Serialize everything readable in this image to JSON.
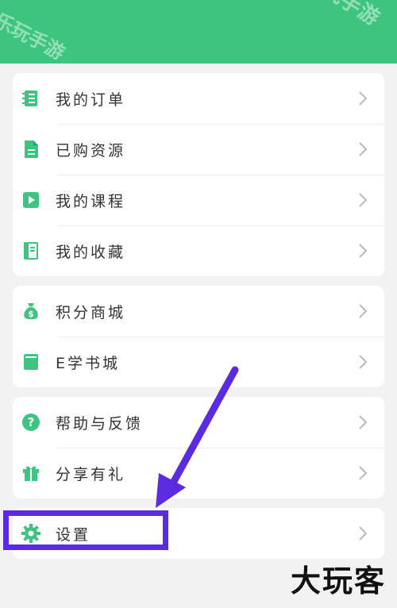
{
  "watermark": {
    "top": "乐玩手游",
    "left": "乐玩手游"
  },
  "card1": {
    "items": [
      {
        "label": "我的订单",
        "icon": "order-list-icon"
      },
      {
        "label": "已购资源",
        "icon": "document-icon"
      },
      {
        "label": "我的课程",
        "icon": "play-video-icon"
      },
      {
        "label": "我的收藏",
        "icon": "bookmark-book-icon"
      }
    ]
  },
  "card2": {
    "items": [
      {
        "label": "积分商城",
        "icon": "money-bag-icon"
      },
      {
        "label": "E学书城",
        "icon": "book-icon"
      }
    ]
  },
  "card3": {
    "items": [
      {
        "label": "帮助与反馈",
        "icon": "help-question-icon"
      },
      {
        "label": "分享有礼",
        "icon": "gift-icon"
      }
    ]
  },
  "card4": {
    "items": [
      {
        "label": "设置",
        "icon": "gear-icon"
      }
    ]
  },
  "brand": "大玩客",
  "colors": {
    "accent": "#3dc47e",
    "highlight": "#5b2be0",
    "chevron": "#bbbbbb"
  }
}
